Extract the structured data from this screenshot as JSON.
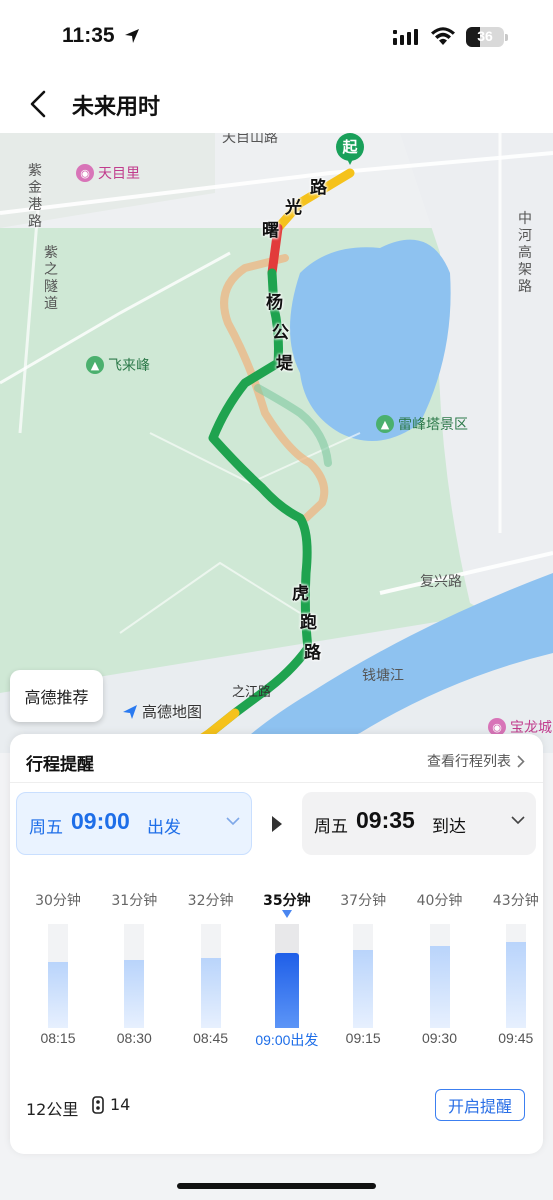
{
  "status_bar": {
    "time": "11:35",
    "battery": "36"
  },
  "nav": {
    "title": "未来用时"
  },
  "map": {
    "road_labels": [
      "天目山路",
      "紫金港路",
      "紫之隧道",
      "中河高架路",
      "复兴路",
      "钱塘江"
    ],
    "route_labels": [
      "曙",
      "光",
      "路",
      "杨",
      "公",
      "堤",
      "虎",
      "跑",
      "路"
    ],
    "poi": {
      "tianmuli": "天目里",
      "feilaifeng": "飞来峰",
      "leifengta": "雷峰塔景区",
      "baolong": "宝龙城"
    },
    "start_pin": "起",
    "recommend_button": "高德推荐",
    "logo_text": "高德地图",
    "river_road": "之江路"
  },
  "card": {
    "title": "行程提醒",
    "view_list": "查看行程列表",
    "depart": {
      "day": "周五",
      "time": "09:00",
      "action": "出发"
    },
    "arrive": {
      "day": "周五",
      "time": "09:35",
      "action": "到达"
    },
    "slots": [
      {
        "duration": "30分钟",
        "time": "08:15",
        "level": 0.63,
        "active": false
      },
      {
        "duration": "31分钟",
        "time": "08:30",
        "level": 0.65,
        "active": false
      },
      {
        "duration": "32分钟",
        "time": "08:45",
        "level": 0.67,
        "active": false
      },
      {
        "duration": "35分钟",
        "time": "09:00出发",
        "level": 0.72,
        "active": true
      },
      {
        "duration": "37分钟",
        "time": "09:15",
        "level": 0.75,
        "active": false
      },
      {
        "duration": "40分钟",
        "time": "09:30",
        "level": 0.79,
        "active": false
      },
      {
        "duration": "43分钟",
        "time": "09:45",
        "level": 0.83,
        "active": false
      }
    ],
    "distance": "12公里",
    "traffic_lights": "14",
    "remind_button": "开启提醒"
  },
  "colors": {
    "accent": "#1e6ee8",
    "route_green": "#1fa34f",
    "route_red": "#e23b3b",
    "route_yellow": "#f5c21b",
    "map_green": "#cfe8d5",
    "water": "#8ec2f0"
  }
}
